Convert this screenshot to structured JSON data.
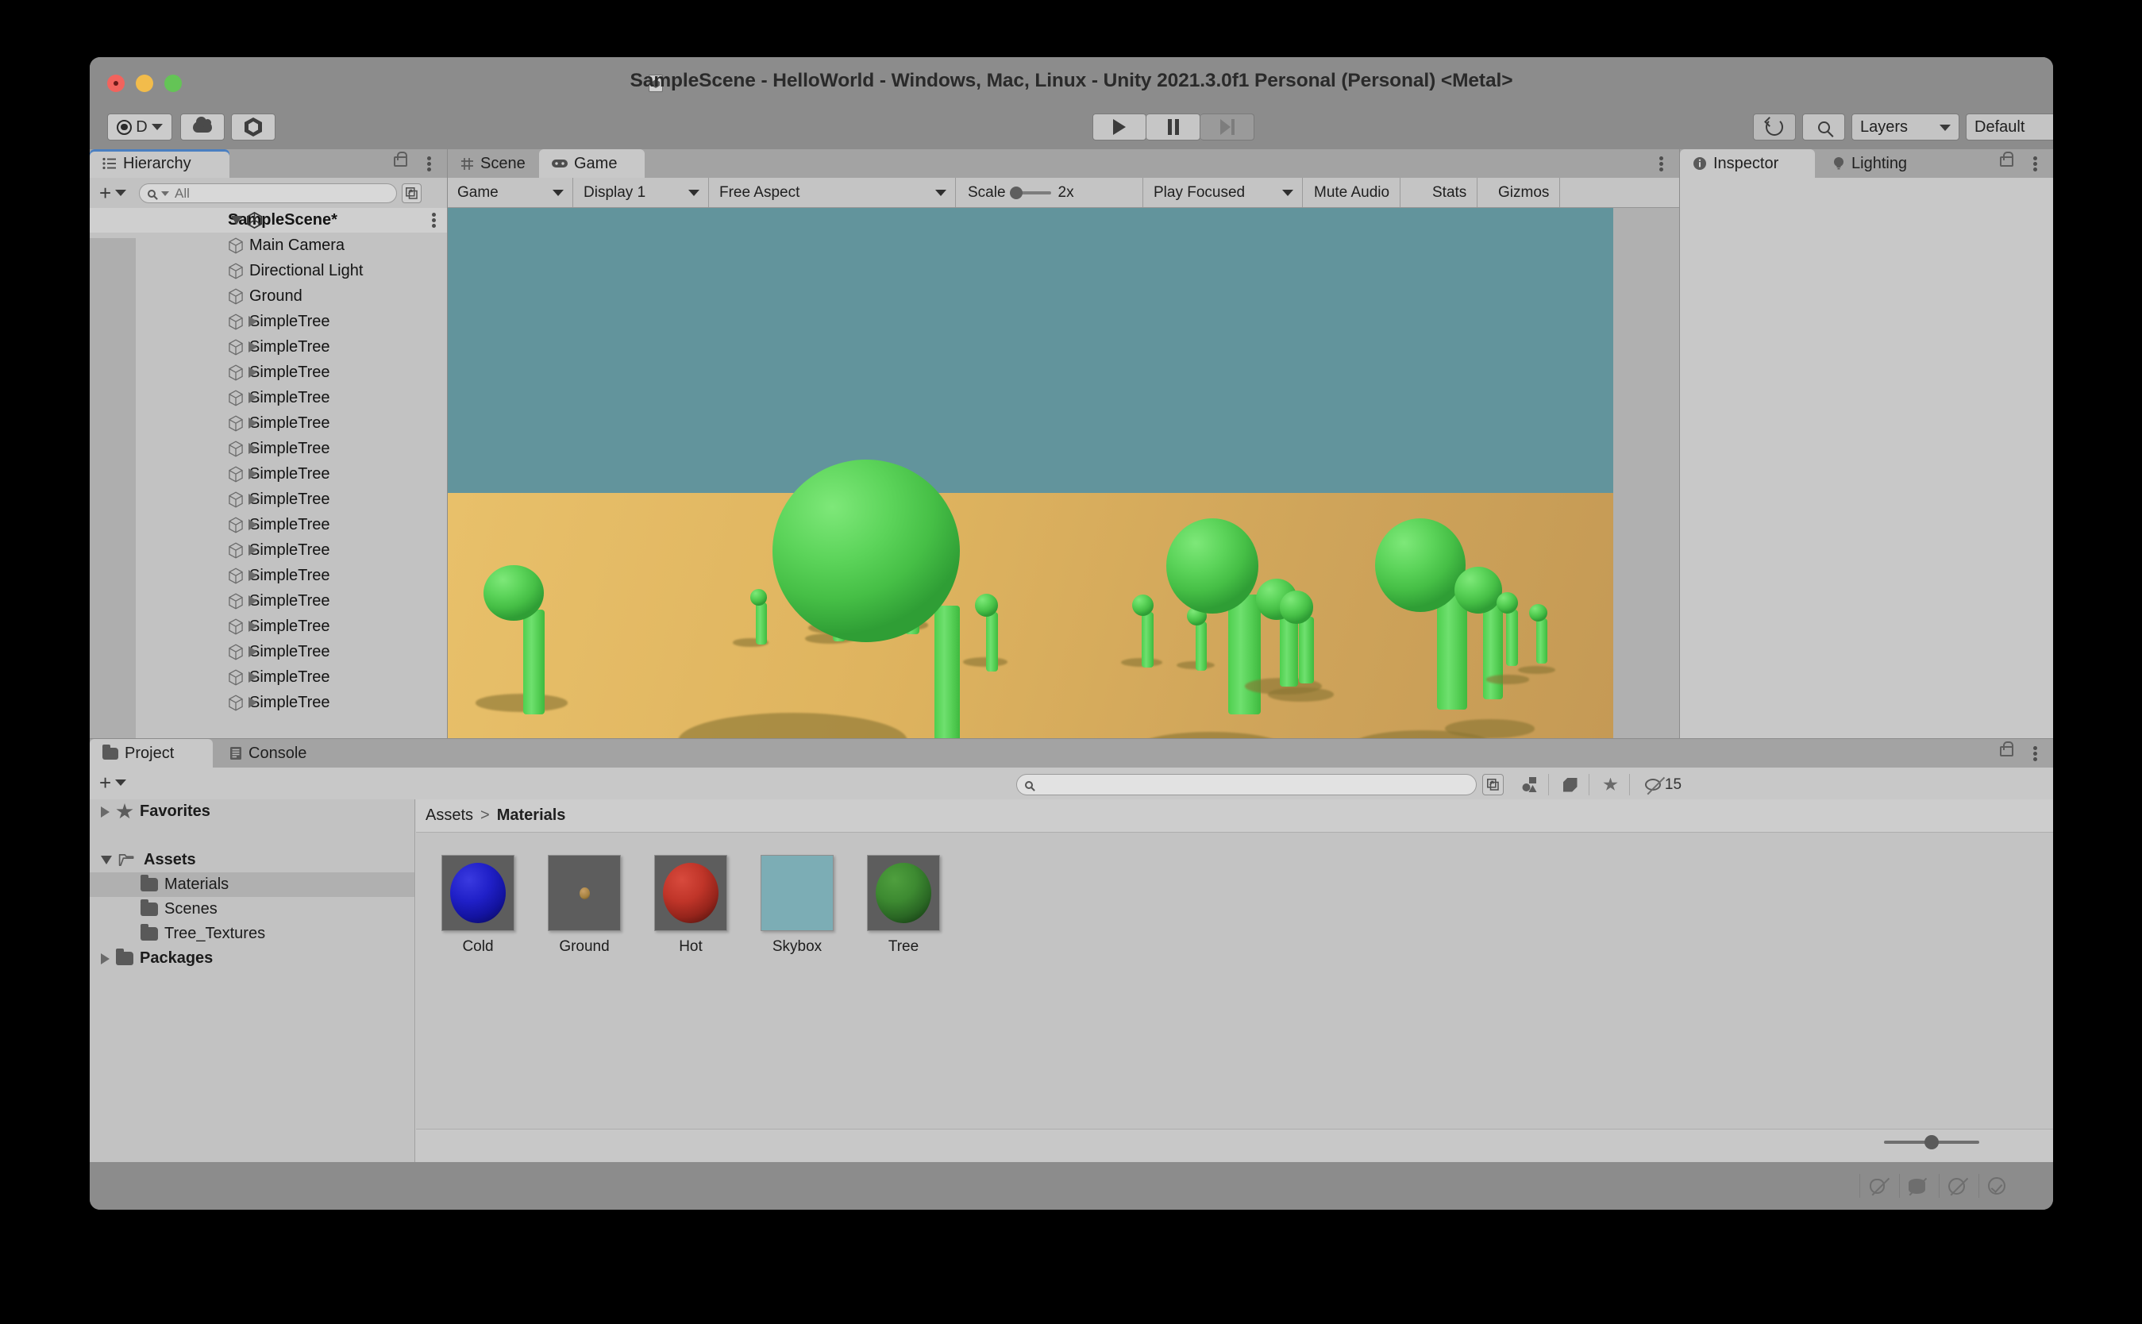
{
  "window": {
    "title": "SampleScene - HelloWorld - Windows, Mac, Linux - Unity 2021.3.0f1 Personal (Personal) <Metal>",
    "traffic_lights": [
      "close",
      "minimize",
      "zoom"
    ]
  },
  "toolbar": {
    "account_label": "D",
    "account_icon": "account-icon",
    "cloud_icon": "cloud-icon",
    "collab_icon": "collab-hex-icon",
    "play_icon": "play-icon",
    "pause_icon": "pause-icon",
    "step_icon": "step-icon",
    "undo_icon": "undo-history-icon",
    "search_icon": "search-icon",
    "layers_label": "Layers",
    "layout_label": "Default"
  },
  "hierarchy": {
    "tab_label": "Hierarchy",
    "tab_icon": "hierarchy-icon",
    "lock_icon": "lock-icon",
    "menu_icon": "kebab-menu-icon",
    "add_label": "+",
    "search_placeholder": "All",
    "scene_name": "SampleScene*",
    "items": [
      {
        "label": "Main Camera",
        "expandable": false
      },
      {
        "label": "Directional Light",
        "expandable": false
      },
      {
        "label": "Ground",
        "expandable": false
      },
      {
        "label": "SimpleTree",
        "expandable": true
      },
      {
        "label": "SimpleTree",
        "expandable": true
      },
      {
        "label": "SimpleTree",
        "expandable": true
      },
      {
        "label": "SimpleTree",
        "expandable": true
      },
      {
        "label": "SimpleTree",
        "expandable": true
      },
      {
        "label": "SimpleTree",
        "expandable": true
      },
      {
        "label": "SimpleTree",
        "expandable": true
      },
      {
        "label": "SimpleTree",
        "expandable": true
      },
      {
        "label": "SimpleTree",
        "expandable": true
      },
      {
        "label": "SimpleTree",
        "expandable": true
      },
      {
        "label": "SimpleTree",
        "expandable": true
      },
      {
        "label": "SimpleTree",
        "expandable": true
      },
      {
        "label": "SimpleTree",
        "expandable": true
      },
      {
        "label": "SimpleTree",
        "expandable": true
      },
      {
        "label": "SimpleTree",
        "expandable": true
      },
      {
        "label": "SimpleTree",
        "expandable": true
      }
    ]
  },
  "center": {
    "tabs": [
      {
        "label": "Scene",
        "icon": "grid-icon",
        "active": false
      },
      {
        "label": "Game",
        "icon": "gamepad-icon",
        "active": true
      }
    ],
    "menu_icon": "kebab-menu-icon",
    "game_toolbar": {
      "view_mode": "Game",
      "display": "Display 1",
      "aspect": "Free Aspect",
      "scale_label": "Scale",
      "scale_value": "2x",
      "play_mode": "Play Focused",
      "mute_audio": "Mute Audio",
      "stats": "Stats",
      "gizmos": "Gizmos"
    },
    "scene_render": {
      "sky_color": "#62949c",
      "ground_color": "#dfb45f",
      "tree_color": "#5cd45a",
      "shadow_color": "#8a7533",
      "description": "3D low-poly scene: 16 capsule-trunk trees with ellipsoid green crowns on a tan ground plane under a teal sky"
    }
  },
  "inspector": {
    "tabs": [
      {
        "label": "Inspector",
        "icon": "info-icon",
        "active": true
      },
      {
        "label": "Lighting",
        "icon": "lightbulb-icon",
        "active": false
      }
    ],
    "lock_icon": "lock-icon",
    "menu_icon": "kebab-menu-icon",
    "body_empty": ""
  },
  "project": {
    "tabs": [
      {
        "label": "Project",
        "icon": "folder-icon",
        "active": true
      },
      {
        "label": "Console",
        "icon": "console-icon",
        "active": false
      }
    ],
    "lock_icon": "lock-icon",
    "menu_icon": "kebab-menu-icon",
    "add_label": "+",
    "search_placeholder": "",
    "search_icon": "search-icon",
    "expand_icon": "open-in-new-icon",
    "filter_type_icon": "shapes-filter-icon",
    "filter_label_icon": "tag-filter-icon",
    "filter_favorite_icon": "star-filter-icon",
    "hidden_count_icon": "eye-off-icon",
    "hidden_count": "15",
    "tree": [
      {
        "label": "Favorites",
        "bold": true,
        "expandable": true,
        "expanded": false,
        "icon": "star-icon",
        "indent": 0,
        "selected": false
      },
      {
        "label": "Assets",
        "bold": true,
        "expandable": true,
        "expanded": true,
        "icon": "folder-open-icon",
        "indent": 0,
        "selected": false
      },
      {
        "label": "Materials",
        "bold": false,
        "expandable": false,
        "expanded": false,
        "icon": "folder-icon",
        "indent": 1,
        "selected": true
      },
      {
        "label": "Scenes",
        "bold": false,
        "expandable": false,
        "expanded": false,
        "icon": "folder-icon",
        "indent": 1,
        "selected": false
      },
      {
        "label": "Tree_Textures",
        "bold": false,
        "expandable": false,
        "expanded": false,
        "icon": "folder-icon",
        "indent": 1,
        "selected": false
      },
      {
        "label": "Packages",
        "bold": true,
        "expandable": true,
        "expanded": false,
        "icon": "folder-icon",
        "indent": 0,
        "selected": false
      }
    ],
    "breadcrumb": {
      "root": "Assets",
      "separator": ">",
      "current": "Materials"
    },
    "assets": [
      {
        "name": "Cold",
        "thumb": "sphere",
        "color": "#2020c8"
      },
      {
        "name": "Ground",
        "thumb": "sphere-small",
        "color": "#a5813f"
      },
      {
        "name": "Hot",
        "thumb": "sphere",
        "color": "#c03529"
      },
      {
        "name": "Skybox",
        "thumb": "flat",
        "color": "#7cadb5"
      },
      {
        "name": "Tree",
        "thumb": "sphere",
        "color": "#3d8a31"
      }
    ],
    "zoom_slider_value": "42"
  },
  "statusbar": {
    "icons": [
      "bug-off-icon",
      "cache-server-icon",
      "collab-off-icon",
      "check-circle-icon"
    ]
  }
}
